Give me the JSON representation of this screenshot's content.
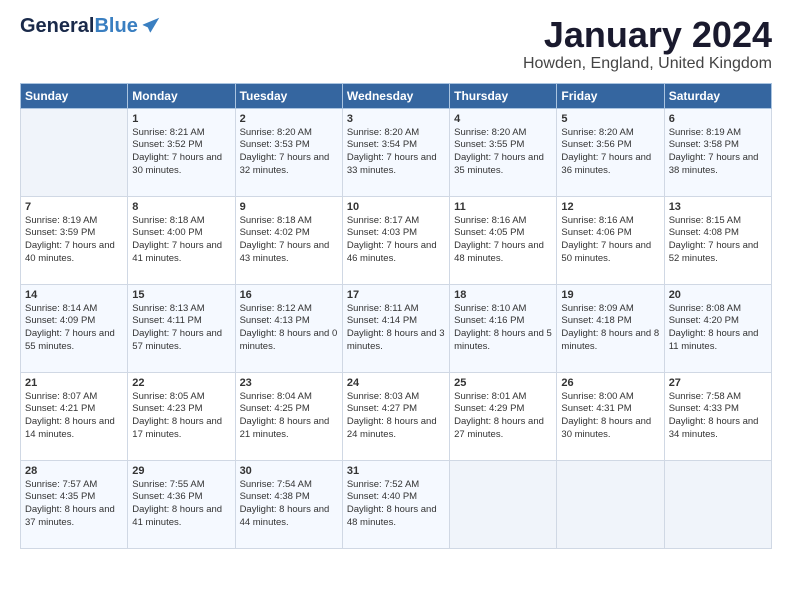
{
  "header": {
    "logo_general": "General",
    "logo_blue": "Blue",
    "title": "January 2024",
    "subtitle": "Howden, England, United Kingdom"
  },
  "days_of_week": [
    "Sunday",
    "Monday",
    "Tuesday",
    "Wednesday",
    "Thursday",
    "Friday",
    "Saturday"
  ],
  "weeks": [
    [
      {
        "day": "",
        "sunrise": "",
        "sunset": "",
        "daylight": ""
      },
      {
        "day": "1",
        "sunrise": "Sunrise: 8:21 AM",
        "sunset": "Sunset: 3:52 PM",
        "daylight": "Daylight: 7 hours and 30 minutes."
      },
      {
        "day": "2",
        "sunrise": "Sunrise: 8:20 AM",
        "sunset": "Sunset: 3:53 PM",
        "daylight": "Daylight: 7 hours and 32 minutes."
      },
      {
        "day": "3",
        "sunrise": "Sunrise: 8:20 AM",
        "sunset": "Sunset: 3:54 PM",
        "daylight": "Daylight: 7 hours and 33 minutes."
      },
      {
        "day": "4",
        "sunrise": "Sunrise: 8:20 AM",
        "sunset": "Sunset: 3:55 PM",
        "daylight": "Daylight: 7 hours and 35 minutes."
      },
      {
        "day": "5",
        "sunrise": "Sunrise: 8:20 AM",
        "sunset": "Sunset: 3:56 PM",
        "daylight": "Daylight: 7 hours and 36 minutes."
      },
      {
        "day": "6",
        "sunrise": "Sunrise: 8:19 AM",
        "sunset": "Sunset: 3:58 PM",
        "daylight": "Daylight: 7 hours and 38 minutes."
      }
    ],
    [
      {
        "day": "7",
        "sunrise": "Sunrise: 8:19 AM",
        "sunset": "Sunset: 3:59 PM",
        "daylight": "Daylight: 7 hours and 40 minutes."
      },
      {
        "day": "8",
        "sunrise": "Sunrise: 8:18 AM",
        "sunset": "Sunset: 4:00 PM",
        "daylight": "Daylight: 7 hours and 41 minutes."
      },
      {
        "day": "9",
        "sunrise": "Sunrise: 8:18 AM",
        "sunset": "Sunset: 4:02 PM",
        "daylight": "Daylight: 7 hours and 43 minutes."
      },
      {
        "day": "10",
        "sunrise": "Sunrise: 8:17 AM",
        "sunset": "Sunset: 4:03 PM",
        "daylight": "Daylight: 7 hours and 46 minutes."
      },
      {
        "day": "11",
        "sunrise": "Sunrise: 8:16 AM",
        "sunset": "Sunset: 4:05 PM",
        "daylight": "Daylight: 7 hours and 48 minutes."
      },
      {
        "day": "12",
        "sunrise": "Sunrise: 8:16 AM",
        "sunset": "Sunset: 4:06 PM",
        "daylight": "Daylight: 7 hours and 50 minutes."
      },
      {
        "day": "13",
        "sunrise": "Sunrise: 8:15 AM",
        "sunset": "Sunset: 4:08 PM",
        "daylight": "Daylight: 7 hours and 52 minutes."
      }
    ],
    [
      {
        "day": "14",
        "sunrise": "Sunrise: 8:14 AM",
        "sunset": "Sunset: 4:09 PM",
        "daylight": "Daylight: 7 hours and 55 minutes."
      },
      {
        "day": "15",
        "sunrise": "Sunrise: 8:13 AM",
        "sunset": "Sunset: 4:11 PM",
        "daylight": "Daylight: 7 hours and 57 minutes."
      },
      {
        "day": "16",
        "sunrise": "Sunrise: 8:12 AM",
        "sunset": "Sunset: 4:13 PM",
        "daylight": "Daylight: 8 hours and 0 minutes."
      },
      {
        "day": "17",
        "sunrise": "Sunrise: 8:11 AM",
        "sunset": "Sunset: 4:14 PM",
        "daylight": "Daylight: 8 hours and 3 minutes."
      },
      {
        "day": "18",
        "sunrise": "Sunrise: 8:10 AM",
        "sunset": "Sunset: 4:16 PM",
        "daylight": "Daylight: 8 hours and 5 minutes."
      },
      {
        "day": "19",
        "sunrise": "Sunrise: 8:09 AM",
        "sunset": "Sunset: 4:18 PM",
        "daylight": "Daylight: 8 hours and 8 minutes."
      },
      {
        "day": "20",
        "sunrise": "Sunrise: 8:08 AM",
        "sunset": "Sunset: 4:20 PM",
        "daylight": "Daylight: 8 hours and 11 minutes."
      }
    ],
    [
      {
        "day": "21",
        "sunrise": "Sunrise: 8:07 AM",
        "sunset": "Sunset: 4:21 PM",
        "daylight": "Daylight: 8 hours and 14 minutes."
      },
      {
        "day": "22",
        "sunrise": "Sunrise: 8:05 AM",
        "sunset": "Sunset: 4:23 PM",
        "daylight": "Daylight: 8 hours and 17 minutes."
      },
      {
        "day": "23",
        "sunrise": "Sunrise: 8:04 AM",
        "sunset": "Sunset: 4:25 PM",
        "daylight": "Daylight: 8 hours and 21 minutes."
      },
      {
        "day": "24",
        "sunrise": "Sunrise: 8:03 AM",
        "sunset": "Sunset: 4:27 PM",
        "daylight": "Daylight: 8 hours and 24 minutes."
      },
      {
        "day": "25",
        "sunrise": "Sunrise: 8:01 AM",
        "sunset": "Sunset: 4:29 PM",
        "daylight": "Daylight: 8 hours and 27 minutes."
      },
      {
        "day": "26",
        "sunrise": "Sunrise: 8:00 AM",
        "sunset": "Sunset: 4:31 PM",
        "daylight": "Daylight: 8 hours and 30 minutes."
      },
      {
        "day": "27",
        "sunrise": "Sunrise: 7:58 AM",
        "sunset": "Sunset: 4:33 PM",
        "daylight": "Daylight: 8 hours and 34 minutes."
      }
    ],
    [
      {
        "day": "28",
        "sunrise": "Sunrise: 7:57 AM",
        "sunset": "Sunset: 4:35 PM",
        "daylight": "Daylight: 8 hours and 37 minutes."
      },
      {
        "day": "29",
        "sunrise": "Sunrise: 7:55 AM",
        "sunset": "Sunset: 4:36 PM",
        "daylight": "Daylight: 8 hours and 41 minutes."
      },
      {
        "day": "30",
        "sunrise": "Sunrise: 7:54 AM",
        "sunset": "Sunset: 4:38 PM",
        "daylight": "Daylight: 8 hours and 44 minutes."
      },
      {
        "day": "31",
        "sunrise": "Sunrise: 7:52 AM",
        "sunset": "Sunset: 4:40 PM",
        "daylight": "Daylight: 8 hours and 48 minutes."
      },
      {
        "day": "",
        "sunrise": "",
        "sunset": "",
        "daylight": ""
      },
      {
        "day": "",
        "sunrise": "",
        "sunset": "",
        "daylight": ""
      },
      {
        "day": "",
        "sunrise": "",
        "sunset": "",
        "daylight": ""
      }
    ]
  ]
}
